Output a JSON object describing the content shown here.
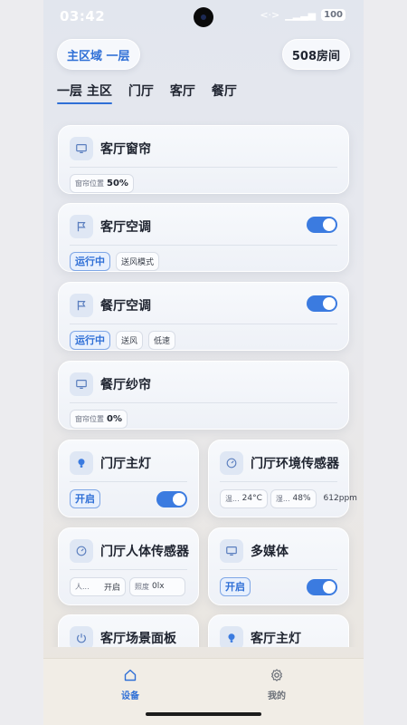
{
  "status_bar": {
    "time": "03:42",
    "battery": "100"
  },
  "header": {
    "area_chip": "主区域 一层",
    "room_chip": "508房间"
  },
  "tabs": [
    {
      "label": "一层 主区",
      "active": true
    },
    {
      "label": "门厅"
    },
    {
      "label": "客厅"
    },
    {
      "label": "餐厅"
    }
  ],
  "devices": {
    "living_curtain": {
      "title": "客厅窗帘",
      "icon": "monitor-icon",
      "pos_label": "窗帘位置",
      "pos_value": "50%"
    },
    "living_ac": {
      "title": "客厅空调",
      "icon": "flag-icon",
      "toggle": "on",
      "status": "运行中",
      "mode": "送风模式"
    },
    "dining_ac": {
      "title": "餐厅空调",
      "icon": "flag-icon",
      "toggle": "on",
      "status": "运行中",
      "mode": "送风",
      "speed": "低速"
    },
    "dining_sheer": {
      "title": "餐厅纱帘",
      "icon": "monitor-icon",
      "pos_label": "窗帘位置",
      "pos_value": "0%"
    },
    "hall_light": {
      "title": "门厅主灯",
      "icon": "bulb-icon",
      "toggle": "on",
      "status": "开启"
    },
    "hall_env": {
      "title": "门厅环境传感器",
      "icon": "gauge-icon",
      "temp_label": "温...",
      "temp": "24°C",
      "hum_label": "湿...",
      "hum": "48%",
      "co2": "612ppm"
    },
    "hall_motion": {
      "title": "门厅人体传感器",
      "icon": "gauge-icon",
      "presence_label": "人...",
      "presence": "开启",
      "lux_label": "照度",
      "lux": "0lx"
    },
    "multimedia": {
      "title": "多媒体",
      "icon": "monitor-icon",
      "toggle": "on",
      "status": "开启"
    },
    "living_scene": {
      "title": "客厅场景面板",
      "icon": "power-icon"
    },
    "living_light": {
      "title": "客厅主灯",
      "icon": "bulb-icon"
    }
  },
  "bottom_nav": [
    {
      "label": "设备",
      "icon": "home-icon",
      "active": true
    },
    {
      "label": "我的",
      "icon": "gear-icon"
    }
  ],
  "colors": {
    "accent": "#2f6fd6",
    "toggle_on": "#3b7be0",
    "icon_bg": "#dfe7f4"
  }
}
